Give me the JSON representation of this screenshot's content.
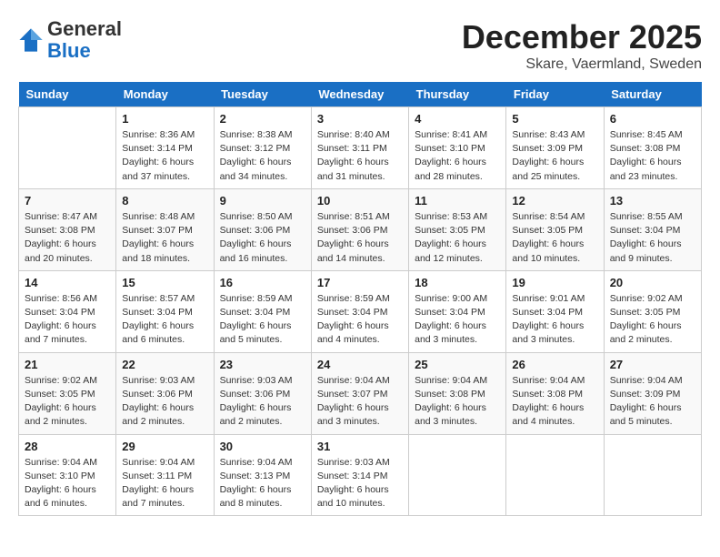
{
  "header": {
    "logo": {
      "line1": "General",
      "line2": "Blue"
    },
    "title": "December 2025",
    "location": "Skare, Vaermland, Sweden"
  },
  "weekdays": [
    "Sunday",
    "Monday",
    "Tuesday",
    "Wednesday",
    "Thursday",
    "Friday",
    "Saturday"
  ],
  "weeks": [
    [
      {
        "day": "",
        "sunrise": "",
        "sunset": "",
        "daylight": ""
      },
      {
        "day": "1",
        "sunrise": "Sunrise: 8:36 AM",
        "sunset": "Sunset: 3:14 PM",
        "daylight": "Daylight: 6 hours and 37 minutes."
      },
      {
        "day": "2",
        "sunrise": "Sunrise: 8:38 AM",
        "sunset": "Sunset: 3:12 PM",
        "daylight": "Daylight: 6 hours and 34 minutes."
      },
      {
        "day": "3",
        "sunrise": "Sunrise: 8:40 AM",
        "sunset": "Sunset: 3:11 PM",
        "daylight": "Daylight: 6 hours and 31 minutes."
      },
      {
        "day": "4",
        "sunrise": "Sunrise: 8:41 AM",
        "sunset": "Sunset: 3:10 PM",
        "daylight": "Daylight: 6 hours and 28 minutes."
      },
      {
        "day": "5",
        "sunrise": "Sunrise: 8:43 AM",
        "sunset": "Sunset: 3:09 PM",
        "daylight": "Daylight: 6 hours and 25 minutes."
      },
      {
        "day": "6",
        "sunrise": "Sunrise: 8:45 AM",
        "sunset": "Sunset: 3:08 PM",
        "daylight": "Daylight: 6 hours and 23 minutes."
      }
    ],
    [
      {
        "day": "7",
        "sunrise": "Sunrise: 8:47 AM",
        "sunset": "Sunset: 3:08 PM",
        "daylight": "Daylight: 6 hours and 20 minutes."
      },
      {
        "day": "8",
        "sunrise": "Sunrise: 8:48 AM",
        "sunset": "Sunset: 3:07 PM",
        "daylight": "Daylight: 6 hours and 18 minutes."
      },
      {
        "day": "9",
        "sunrise": "Sunrise: 8:50 AM",
        "sunset": "Sunset: 3:06 PM",
        "daylight": "Daylight: 6 hours and 16 minutes."
      },
      {
        "day": "10",
        "sunrise": "Sunrise: 8:51 AM",
        "sunset": "Sunset: 3:06 PM",
        "daylight": "Daylight: 6 hours and 14 minutes."
      },
      {
        "day": "11",
        "sunrise": "Sunrise: 8:53 AM",
        "sunset": "Sunset: 3:05 PM",
        "daylight": "Daylight: 6 hours and 12 minutes."
      },
      {
        "day": "12",
        "sunrise": "Sunrise: 8:54 AM",
        "sunset": "Sunset: 3:05 PM",
        "daylight": "Daylight: 6 hours and 10 minutes."
      },
      {
        "day": "13",
        "sunrise": "Sunrise: 8:55 AM",
        "sunset": "Sunset: 3:04 PM",
        "daylight": "Daylight: 6 hours and 9 minutes."
      }
    ],
    [
      {
        "day": "14",
        "sunrise": "Sunrise: 8:56 AM",
        "sunset": "Sunset: 3:04 PM",
        "daylight": "Daylight: 6 hours and 7 minutes."
      },
      {
        "day": "15",
        "sunrise": "Sunrise: 8:57 AM",
        "sunset": "Sunset: 3:04 PM",
        "daylight": "Daylight: 6 hours and 6 minutes."
      },
      {
        "day": "16",
        "sunrise": "Sunrise: 8:59 AM",
        "sunset": "Sunset: 3:04 PM",
        "daylight": "Daylight: 6 hours and 5 minutes."
      },
      {
        "day": "17",
        "sunrise": "Sunrise: 8:59 AM",
        "sunset": "Sunset: 3:04 PM",
        "daylight": "Daylight: 6 hours and 4 minutes."
      },
      {
        "day": "18",
        "sunrise": "Sunrise: 9:00 AM",
        "sunset": "Sunset: 3:04 PM",
        "daylight": "Daylight: 6 hours and 3 minutes."
      },
      {
        "day": "19",
        "sunrise": "Sunrise: 9:01 AM",
        "sunset": "Sunset: 3:04 PM",
        "daylight": "Daylight: 6 hours and 3 minutes."
      },
      {
        "day": "20",
        "sunrise": "Sunrise: 9:02 AM",
        "sunset": "Sunset: 3:05 PM",
        "daylight": "Daylight: 6 hours and 2 minutes."
      }
    ],
    [
      {
        "day": "21",
        "sunrise": "Sunrise: 9:02 AM",
        "sunset": "Sunset: 3:05 PM",
        "daylight": "Daylight: 6 hours and 2 minutes."
      },
      {
        "day": "22",
        "sunrise": "Sunrise: 9:03 AM",
        "sunset": "Sunset: 3:06 PM",
        "daylight": "Daylight: 6 hours and 2 minutes."
      },
      {
        "day": "23",
        "sunrise": "Sunrise: 9:03 AM",
        "sunset": "Sunset: 3:06 PM",
        "daylight": "Daylight: 6 hours and 2 minutes."
      },
      {
        "day": "24",
        "sunrise": "Sunrise: 9:04 AM",
        "sunset": "Sunset: 3:07 PM",
        "daylight": "Daylight: 6 hours and 3 minutes."
      },
      {
        "day": "25",
        "sunrise": "Sunrise: 9:04 AM",
        "sunset": "Sunset: 3:08 PM",
        "daylight": "Daylight: 6 hours and 3 minutes."
      },
      {
        "day": "26",
        "sunrise": "Sunrise: 9:04 AM",
        "sunset": "Sunset: 3:08 PM",
        "daylight": "Daylight: 6 hours and 4 minutes."
      },
      {
        "day": "27",
        "sunrise": "Sunrise: 9:04 AM",
        "sunset": "Sunset: 3:09 PM",
        "daylight": "Daylight: 6 hours and 5 minutes."
      }
    ],
    [
      {
        "day": "28",
        "sunrise": "Sunrise: 9:04 AM",
        "sunset": "Sunset: 3:10 PM",
        "daylight": "Daylight: 6 hours and 6 minutes."
      },
      {
        "day": "29",
        "sunrise": "Sunrise: 9:04 AM",
        "sunset": "Sunset: 3:11 PM",
        "daylight": "Daylight: 6 hours and 7 minutes."
      },
      {
        "day": "30",
        "sunrise": "Sunrise: 9:04 AM",
        "sunset": "Sunset: 3:13 PM",
        "daylight": "Daylight: 6 hours and 8 minutes."
      },
      {
        "day": "31",
        "sunrise": "Sunrise: 9:03 AM",
        "sunset": "Sunset: 3:14 PM",
        "daylight": "Daylight: 6 hours and 10 minutes."
      },
      {
        "day": "",
        "sunrise": "",
        "sunset": "",
        "daylight": ""
      },
      {
        "day": "",
        "sunrise": "",
        "sunset": "",
        "daylight": ""
      },
      {
        "day": "",
        "sunrise": "",
        "sunset": "",
        "daylight": ""
      }
    ]
  ]
}
